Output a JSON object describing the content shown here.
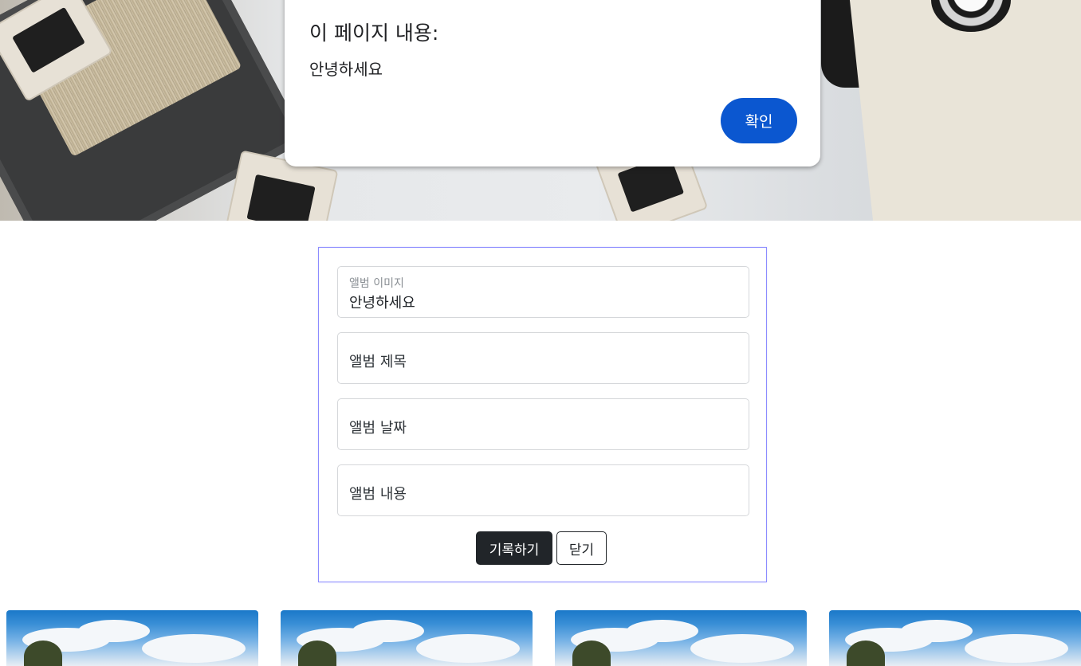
{
  "alert": {
    "title": "이 페이지 내용:",
    "message": "안녕하세요",
    "ok_label": "확인"
  },
  "form": {
    "image_field": {
      "label": "앨범 이미지",
      "value": "안녕하세요"
    },
    "title_field": {
      "placeholder": "앨범 제목"
    },
    "date_field": {
      "placeholder": "앨범 날짜"
    },
    "content_field": {
      "placeholder": "앨범 내용"
    },
    "submit_label": "기록하기",
    "close_label": "닫기"
  },
  "colors": {
    "alert_button": "#0b57d0",
    "submit_button": "#212529",
    "form_border": "#8c8cff"
  },
  "album_cards_visible": 4
}
